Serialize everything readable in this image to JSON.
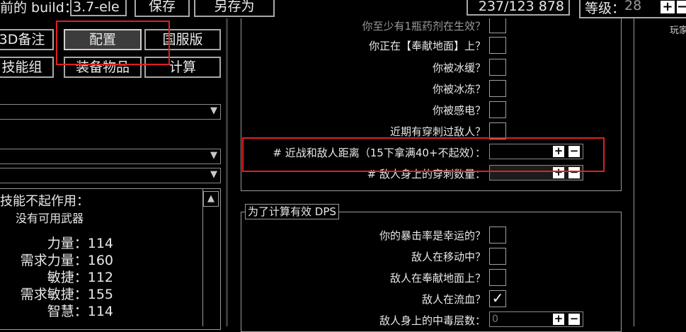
{
  "topbar": {
    "build_label": "前的 build：",
    "build_value": "3.7-ele",
    "save_label": "保存",
    "save_as_label": "另存为",
    "points_value": "237/123  878",
    "level_label": "等级：",
    "level_value": "28",
    "right_cut": "玩家"
  },
  "left_buttons": {
    "notes": "3D备注",
    "config": "配置",
    "cn_version": "国服版",
    "skill_groups": "技能组",
    "items": "装备物品",
    "calc": "计算"
  },
  "left_panel": {
    "warning": "技能不起作用：",
    "no_weapon": "没有可用武器",
    "stats": [
      {
        "label": "力量：",
        "value": "114"
      },
      {
        "label": "需求力量：",
        "value": "160"
      },
      {
        "label": "敏捷：",
        "value": "112"
      },
      {
        "label": "需求敏捷：",
        "value": "155"
      },
      {
        "label": "智慧：",
        "value": "114"
      }
    ]
  },
  "config_top": {
    "cut_question": "你至少有1瓶药剂在生效？",
    "questions": [
      {
        "label": "你正在【奉献地面】上？",
        "checked": false
      },
      {
        "label": "你被冰缓？",
        "checked": false
      },
      {
        "label": "你被冰冻？",
        "checked": false
      },
      {
        "label": "你被感电？",
        "checked": false
      },
      {
        "label": "近期有穿刺过敌人？",
        "checked": false
      }
    ],
    "distance_label": "# 近战和敌人距离（15下拿满40+不起效）：",
    "distance_value": "",
    "impale_label": "# 敌人身上的穿刺数量：",
    "impale_value": ""
  },
  "dps_section": {
    "title": "为了计算有效 DPS",
    "questions": [
      {
        "label": "你的暴击率是幸运的？",
        "checked": false
      },
      {
        "label": "敌人在移动中？",
        "checked": false
      },
      {
        "label": "敌人在奉献地面上？",
        "checked": false
      },
      {
        "label": "敌人在流血？",
        "checked": true
      }
    ],
    "poison_label": "敌人身上的中毒层数：",
    "poison_placeholder": "0"
  },
  "glyphs": {
    "plus": "+",
    "minus": "−",
    "check": "✓",
    "dropdown": "▼",
    "scroll_up": "▲"
  }
}
